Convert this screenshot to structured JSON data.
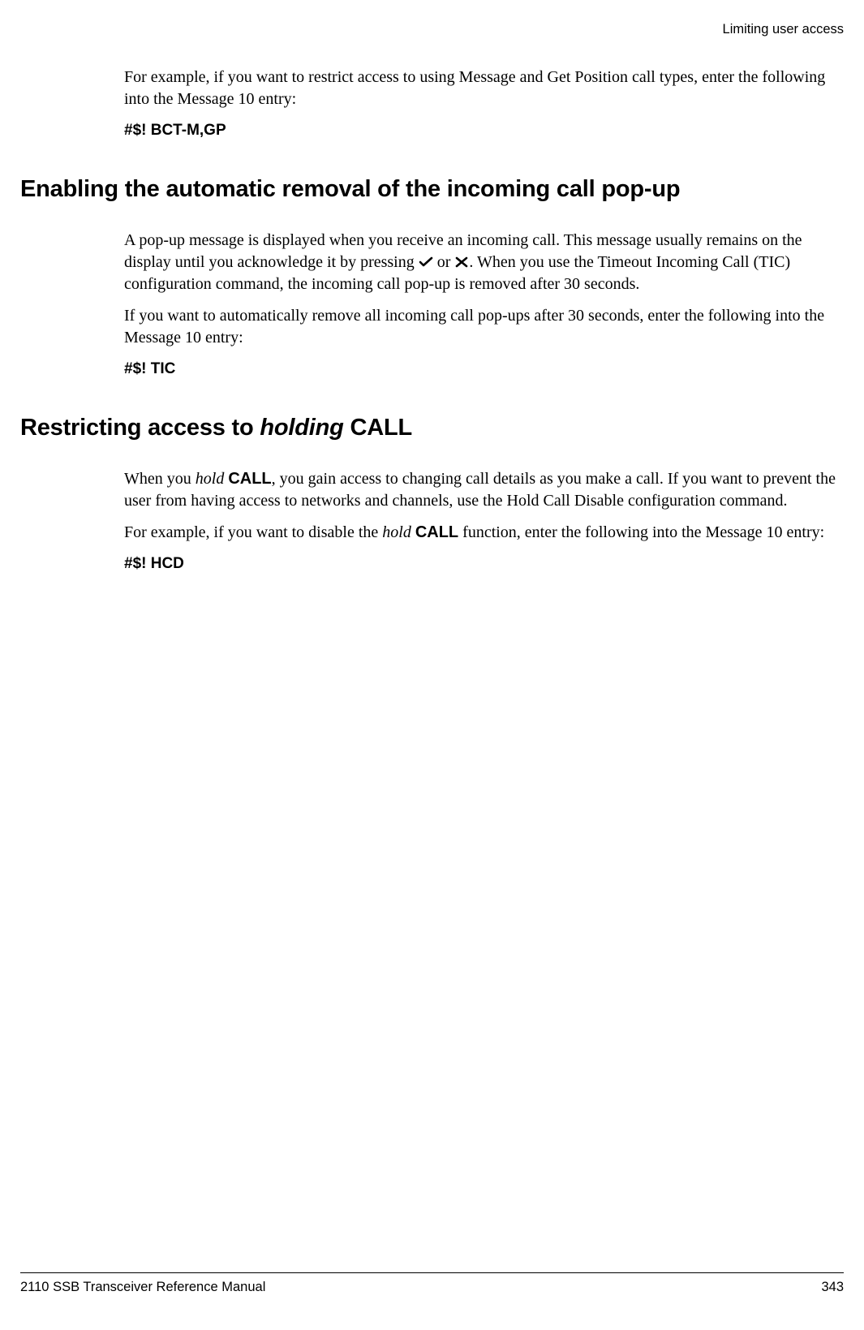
{
  "header": {
    "section": "Limiting user access"
  },
  "intro": {
    "para1": "For example, if you want to restrict access to using Message and Get Position call types, enter the following into the Message 10 entry:",
    "cmd1": "#$! BCT-M,GP"
  },
  "section1": {
    "heading": "Enabling the automatic removal of the incoming call pop-up",
    "para1_pre": "A pop-up message is displayed when you receive an incoming call. This message usually remains on the display until you acknowledge it by pressing ",
    "para1_mid": " or ",
    "para1_post": ". When you use the Timeout Incoming Call (TIC) configuration command, the incoming call pop-up is removed after 30 seconds.",
    "para2": "If you want to automatically remove all incoming call pop-ups after 30 seconds, enter the following into the Message 10 entry:",
    "cmd": "#$! TIC"
  },
  "section2": {
    "heading_pre": "Restricting access to ",
    "heading_ital": "holding",
    "heading_post": " CALL",
    "para1_pre": "When you ",
    "para1_hold": "hold",
    "para1_space": " ",
    "para1_call": "CALL",
    "para1_post": ", you gain access to changing call details as you make a call. If you want to prevent the user from having access to networks and channels, use the Hold Call Disable configuration command.",
    "para2_pre": "For example, if you want to disable the ",
    "para2_hold": "hold",
    "para2_space": " ",
    "para2_call": "CALL",
    "para2_post": " function, enter the following into the Message 10 entry:",
    "cmd": "#$! HCD"
  },
  "footer": {
    "manual": "2110 SSB Transceiver Reference Manual",
    "page": "343"
  },
  "icons": {
    "check": "check-icon",
    "cross": "cross-icon"
  }
}
